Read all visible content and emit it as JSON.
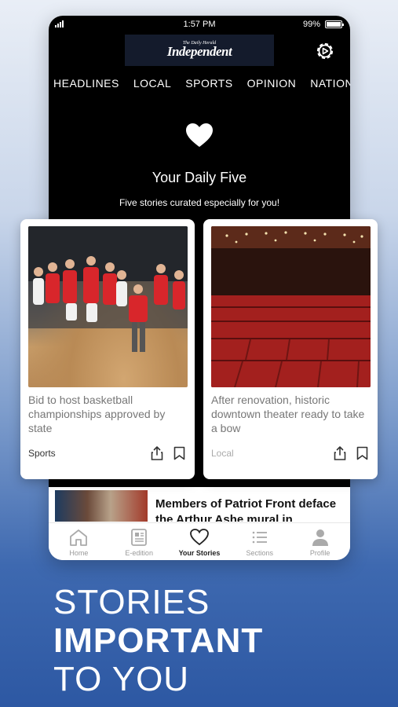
{
  "status": {
    "time": "1:57 PM",
    "battery": "99%",
    "battery_level": 0.99
  },
  "header": {
    "logo_small": "The Daily Herald",
    "logo_main": "Independent"
  },
  "nav_tabs": [
    "HEADLINES",
    "LOCAL",
    "SPORTS",
    "OPINION",
    "NATION"
  ],
  "hero": {
    "title": "Your Daily Five",
    "subtitle": "Five stories curated especially for you!"
  },
  "cards": [
    {
      "headline": "Bid to host basketball championships approved by state",
      "section": "Sports",
      "section_color": "#333333",
      "image": "basketball-players"
    },
    {
      "headline": "After renovation, historic downtown theater ready to take a bow",
      "section": "Local",
      "section_color": "#aaaaaa",
      "image": "theater-seats"
    }
  ],
  "story_row": {
    "title": "Members of Patriot Front deface the Arthur Ashe mural in"
  },
  "bottom_nav": [
    {
      "label": "Home",
      "icon": "home-icon"
    },
    {
      "label": "E-edition",
      "icon": "newspaper-icon"
    },
    {
      "label": "Your Stories",
      "icon": "heart-icon",
      "active": true
    },
    {
      "label": "Sections",
      "icon": "list-icon"
    },
    {
      "label": "Profile",
      "icon": "person-icon"
    }
  ],
  "tagline": {
    "line1": "STORIES",
    "line2": "IMPORTANT",
    "line3": "TO YOU"
  },
  "colors": {
    "accent_dark": "#000000",
    "background_blue": "#2d58a3"
  }
}
